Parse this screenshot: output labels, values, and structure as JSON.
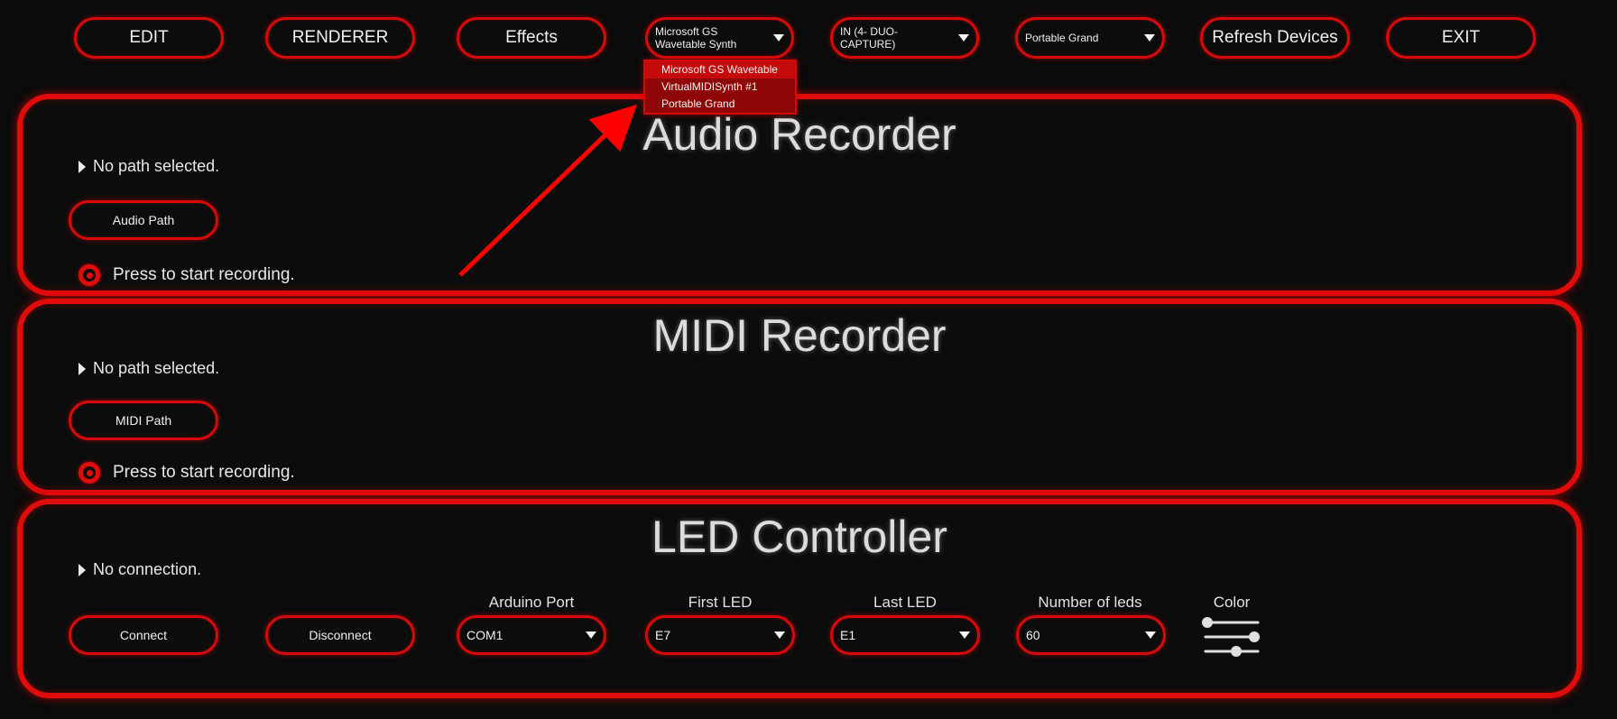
{
  "toolbar": {
    "edit_label": "EDIT",
    "renderer_label": "RENDERER",
    "effects_label": "Effects",
    "synth_dropdown_value": "Microsoft GS Wavetable Synth",
    "midi_in_dropdown_value": "IN (4- DUO-CAPTURE)",
    "instrument_dropdown_value": "Portable Grand",
    "refresh_label": "Refresh Devices",
    "exit_label": "EXIT"
  },
  "synth_menu": {
    "options": [
      "Microsoft GS Wavetable",
      "VirtualMIDISynth #1",
      "Portable Grand"
    ]
  },
  "audio_recorder": {
    "title": "Audio Recorder",
    "path_status": "No path selected.",
    "path_button": "Audio Path",
    "record_hint": "Press to start recording."
  },
  "midi_recorder": {
    "title": "MIDI Recorder",
    "path_status": "No path selected.",
    "path_button": "MIDI Path",
    "record_hint": "Press to start recording."
  },
  "led_controller": {
    "title": "LED Controller",
    "connection_status": "No connection.",
    "connect_label": "Connect",
    "disconnect_label": "Disconnect",
    "arduino_port_label": "Arduino Port",
    "arduino_port_value": "COM1",
    "first_led_label": "First LED",
    "first_led_value": "E7",
    "last_led_label": "Last LED",
    "last_led_value": "E1",
    "num_leds_label": "Number of leds",
    "num_leds_value": "60",
    "color_label": "Color"
  },
  "icons": {
    "dropdown": "chevron-down-icon",
    "status": "triangle-right-icon",
    "record": "record-icon",
    "color": "sliders-icon"
  },
  "colors": {
    "accent": "#e00b0b",
    "background": "#0b0b0b",
    "menu_bg": "#8e0606",
    "text": "#e6e6e6"
  }
}
